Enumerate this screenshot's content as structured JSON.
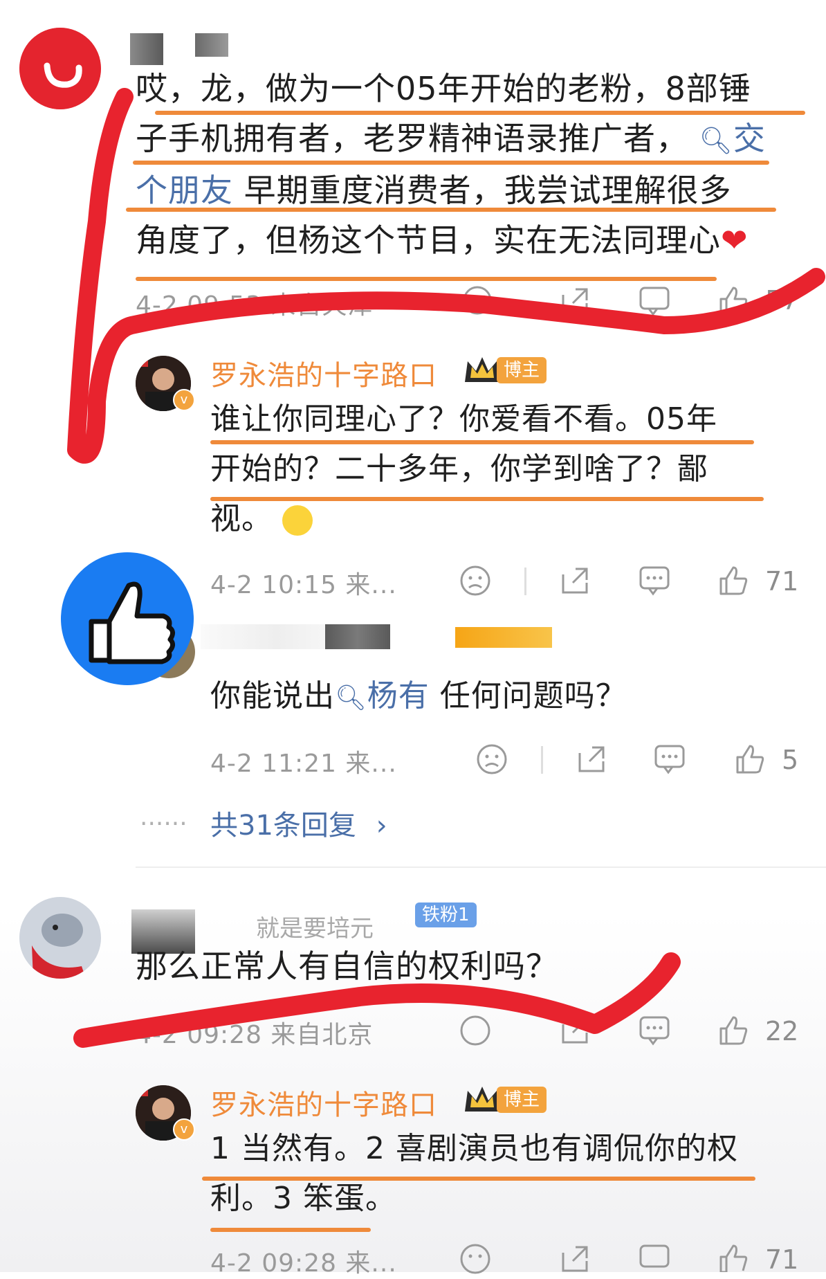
{
  "comment1": {
    "text_lines": [
      "哎，龙，做为一个05年开始的老粉，8部锤",
      "子手机拥有者，老罗精神语录推广者，",
      " 早期重度消费者，我尝试理解很多",
      "角度了，但杨这个节目，实在无法同理心"
    ],
    "topic_link_1": "交",
    "topic_link_2": "个朋友",
    "heart_icon": "red-heart",
    "meta": "4-2 09:53  来自天津",
    "likes": "57"
  },
  "reply1": {
    "author": "罗永浩的十字路口",
    "badge": "博主",
    "text_lines": [
      "谁让你同理心了？你爱看不看。05年",
      "开始的？二十多年，你学到啥了？鄙",
      "视。"
    ],
    "meta": "4-2 10:15  来...",
    "likes": "71"
  },
  "reply2": {
    "text_prefix": "你能说出",
    "topic_link": "杨有",
    "text_suffix": " 任何问题吗？",
    "meta": "4-2 11:21  来...",
    "likes": "5"
  },
  "more_replies": {
    "dots": "......",
    "label": "共31条回复"
  },
  "comment2": {
    "name_fragment": "就是要培元",
    "fan_badge": "铁粉1",
    "text": "那么正常人有自信的权利吗？",
    "meta": "4-2 09:28  来自北京",
    "likes": "22"
  },
  "reply3": {
    "author": "罗永浩的十字路口",
    "badge": "博主",
    "text_lines": [
      "1 当然有。2 喜剧演员也有调侃你的权",
      "利。3 笨蛋。"
    ],
    "meta": "4-2 09:28  来...",
    "likes": "71"
  },
  "colors": {
    "accent_orange": "#ef8a3a",
    "link_blue": "#4a6fa8",
    "red_marker": "#e8232e",
    "thumb_badge_blue": "#1a7cf2"
  }
}
